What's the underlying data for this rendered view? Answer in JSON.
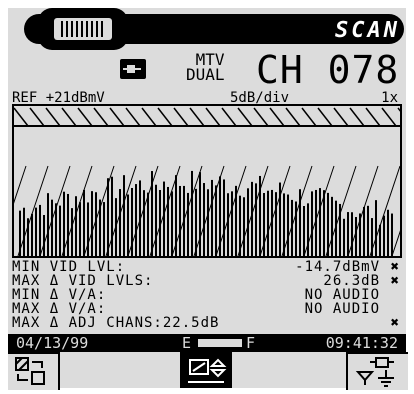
{
  "header": {
    "mode_label": "SCAN",
    "mode_line1": "MTV",
    "mode_line2": "DUAL",
    "channel": "CH 078"
  },
  "spectrum": {
    "ref_label": "REF +21dBmV",
    "scale_label": "5dB/div",
    "zoom_label": "1x"
  },
  "measurements": [
    {
      "label": "MIN VID LVL:",
      "value": "-14.7dBmV"
    },
    {
      "label": "MAX Δ VID LVLS:",
      "value": "26.3dB"
    },
    {
      "label": "MIN Δ V/A:",
      "value": "NO AUDIO"
    },
    {
      "label": "MAX Δ V/A:",
      "value": "NO AUDIO"
    },
    {
      "label": "MAX Δ ADJ CHANS:22.5dB",
      "value": ""
    }
  ],
  "status": {
    "date": "04/13/99",
    "battery_empty": "E",
    "battery_full": "F",
    "time": "09:41:32"
  },
  "icons": {
    "plug": "plug-icon",
    "left_softkey": "swap-display-icon",
    "mid_softkey": "tune-filter-icon",
    "right_softkey": "plug-filter-icon"
  }
}
